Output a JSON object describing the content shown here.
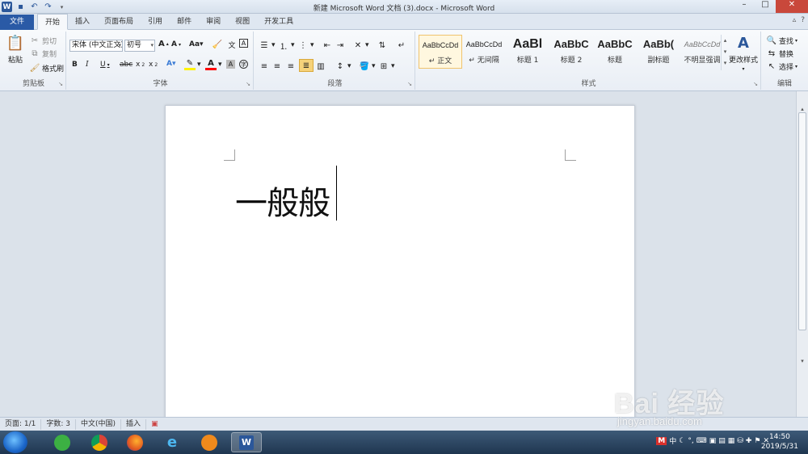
{
  "window": {
    "title": "新建 Microsoft Word 文档 (3).docx - Microsoft Word"
  },
  "tabs": {
    "file": "文件",
    "items": [
      "开始",
      "插入",
      "页面布局",
      "引用",
      "邮件",
      "审阅",
      "视图",
      "开发工具"
    ]
  },
  "ribbon": {
    "clipboard": {
      "label": "剪贴板",
      "paste": "粘贴",
      "cut": "剪切",
      "copy": "复制",
      "format_painter": "格式刷"
    },
    "font": {
      "label": "字体",
      "font_name": "宋体 (中文正文)",
      "font_size": "初号"
    },
    "paragraph": {
      "label": "段落"
    },
    "styles": {
      "label": "样式",
      "items": [
        {
          "sample": "AaBbCcDd",
          "name": "↵ 正文"
        },
        {
          "sample": "AaBbCcDd",
          "name": "↵ 无间隔"
        },
        {
          "sample": "AaBl",
          "name": "标题 1"
        },
        {
          "sample": "AaBbC",
          "name": "标题 2"
        },
        {
          "sample": "AaBbC",
          "name": "标题"
        },
        {
          "sample": "AaBb(",
          "name": "副标题"
        },
        {
          "sample": "AaBbCcDd",
          "name": "不明显强调"
        }
      ],
      "change_styles": "更改样式"
    },
    "editing": {
      "label": "编辑",
      "find": "查找",
      "replace": "替换",
      "select": "选择"
    }
  },
  "document": {
    "text": "一般般"
  },
  "statusbar": {
    "page": "页面: 1/1",
    "words": "字数: 3",
    "language": "中文(中国)",
    "mode": "插入"
  },
  "taskbar": {
    "tray_ime": "中",
    "time": "14:50",
    "date": "2019/5/31"
  },
  "watermark": {
    "brand": "Bai 经验",
    "url": "jingyan.baidu.com"
  },
  "colors": {
    "file_tab": "#2a5aa6",
    "word_blue": "#2b579a",
    "highlight": "#fff200",
    "font_red": "#ff0000"
  }
}
